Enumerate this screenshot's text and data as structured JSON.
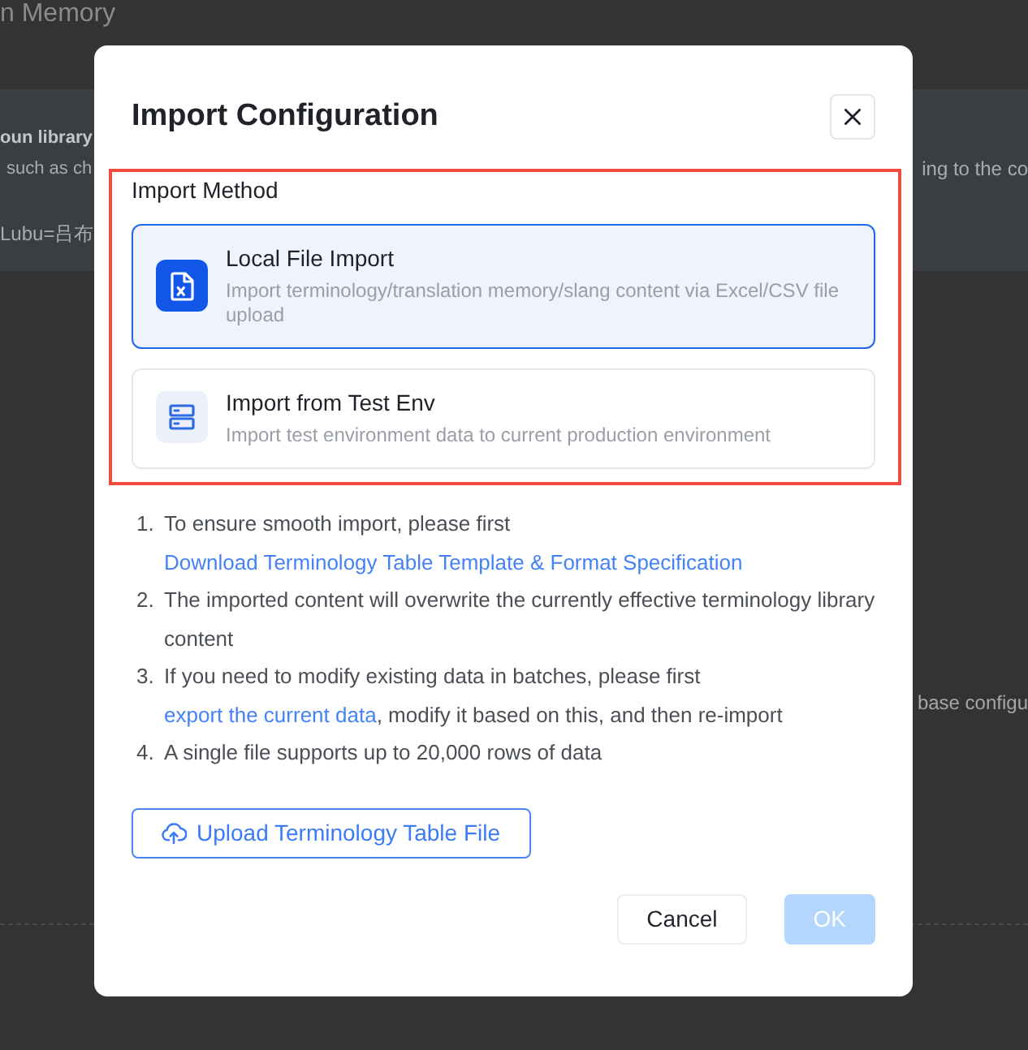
{
  "background": {
    "page_title": "n Memory",
    "section_heading": "oun library",
    "description_start": "such as ch",
    "description_end": "ing to the co",
    "example": "Lubu=吕布",
    "side_text": "base configu"
  },
  "dialog": {
    "title": "Import Configuration",
    "import_method": {
      "label": "Import Method",
      "options": [
        {
          "kind": "file",
          "title": "Local File Import",
          "description": "Import terminology/translation memory/slang content via Excel/CSV file upload",
          "selected": true
        },
        {
          "kind": "server",
          "title": "Import from Test Env",
          "description": "Import test environment data to current production environment",
          "selected": false
        }
      ]
    },
    "instructions": [
      {
        "number": "1.",
        "text": "To ensure smooth import, please first",
        "link": "Download Terminology Table Template & Format Specification"
      },
      {
        "number": "2.",
        "text": "The imported content will overwrite the currently effective terminology library content"
      },
      {
        "number": "3.",
        "text": "If you need to modify existing data in batches, please first",
        "link": "export the current data",
        "after": ", modify it based on this, and then re-import"
      },
      {
        "number": "4.",
        "text": "A single file supports up to 20,000 rows of data"
      }
    ],
    "upload_button": {
      "label": "Upload Terminology Table File"
    },
    "buttons": [
      {
        "kind": "secondary",
        "label": "Cancel",
        "disabled": false
      },
      {
        "kind": "primary",
        "label": "OK",
        "disabled": true
      }
    ]
  }
}
